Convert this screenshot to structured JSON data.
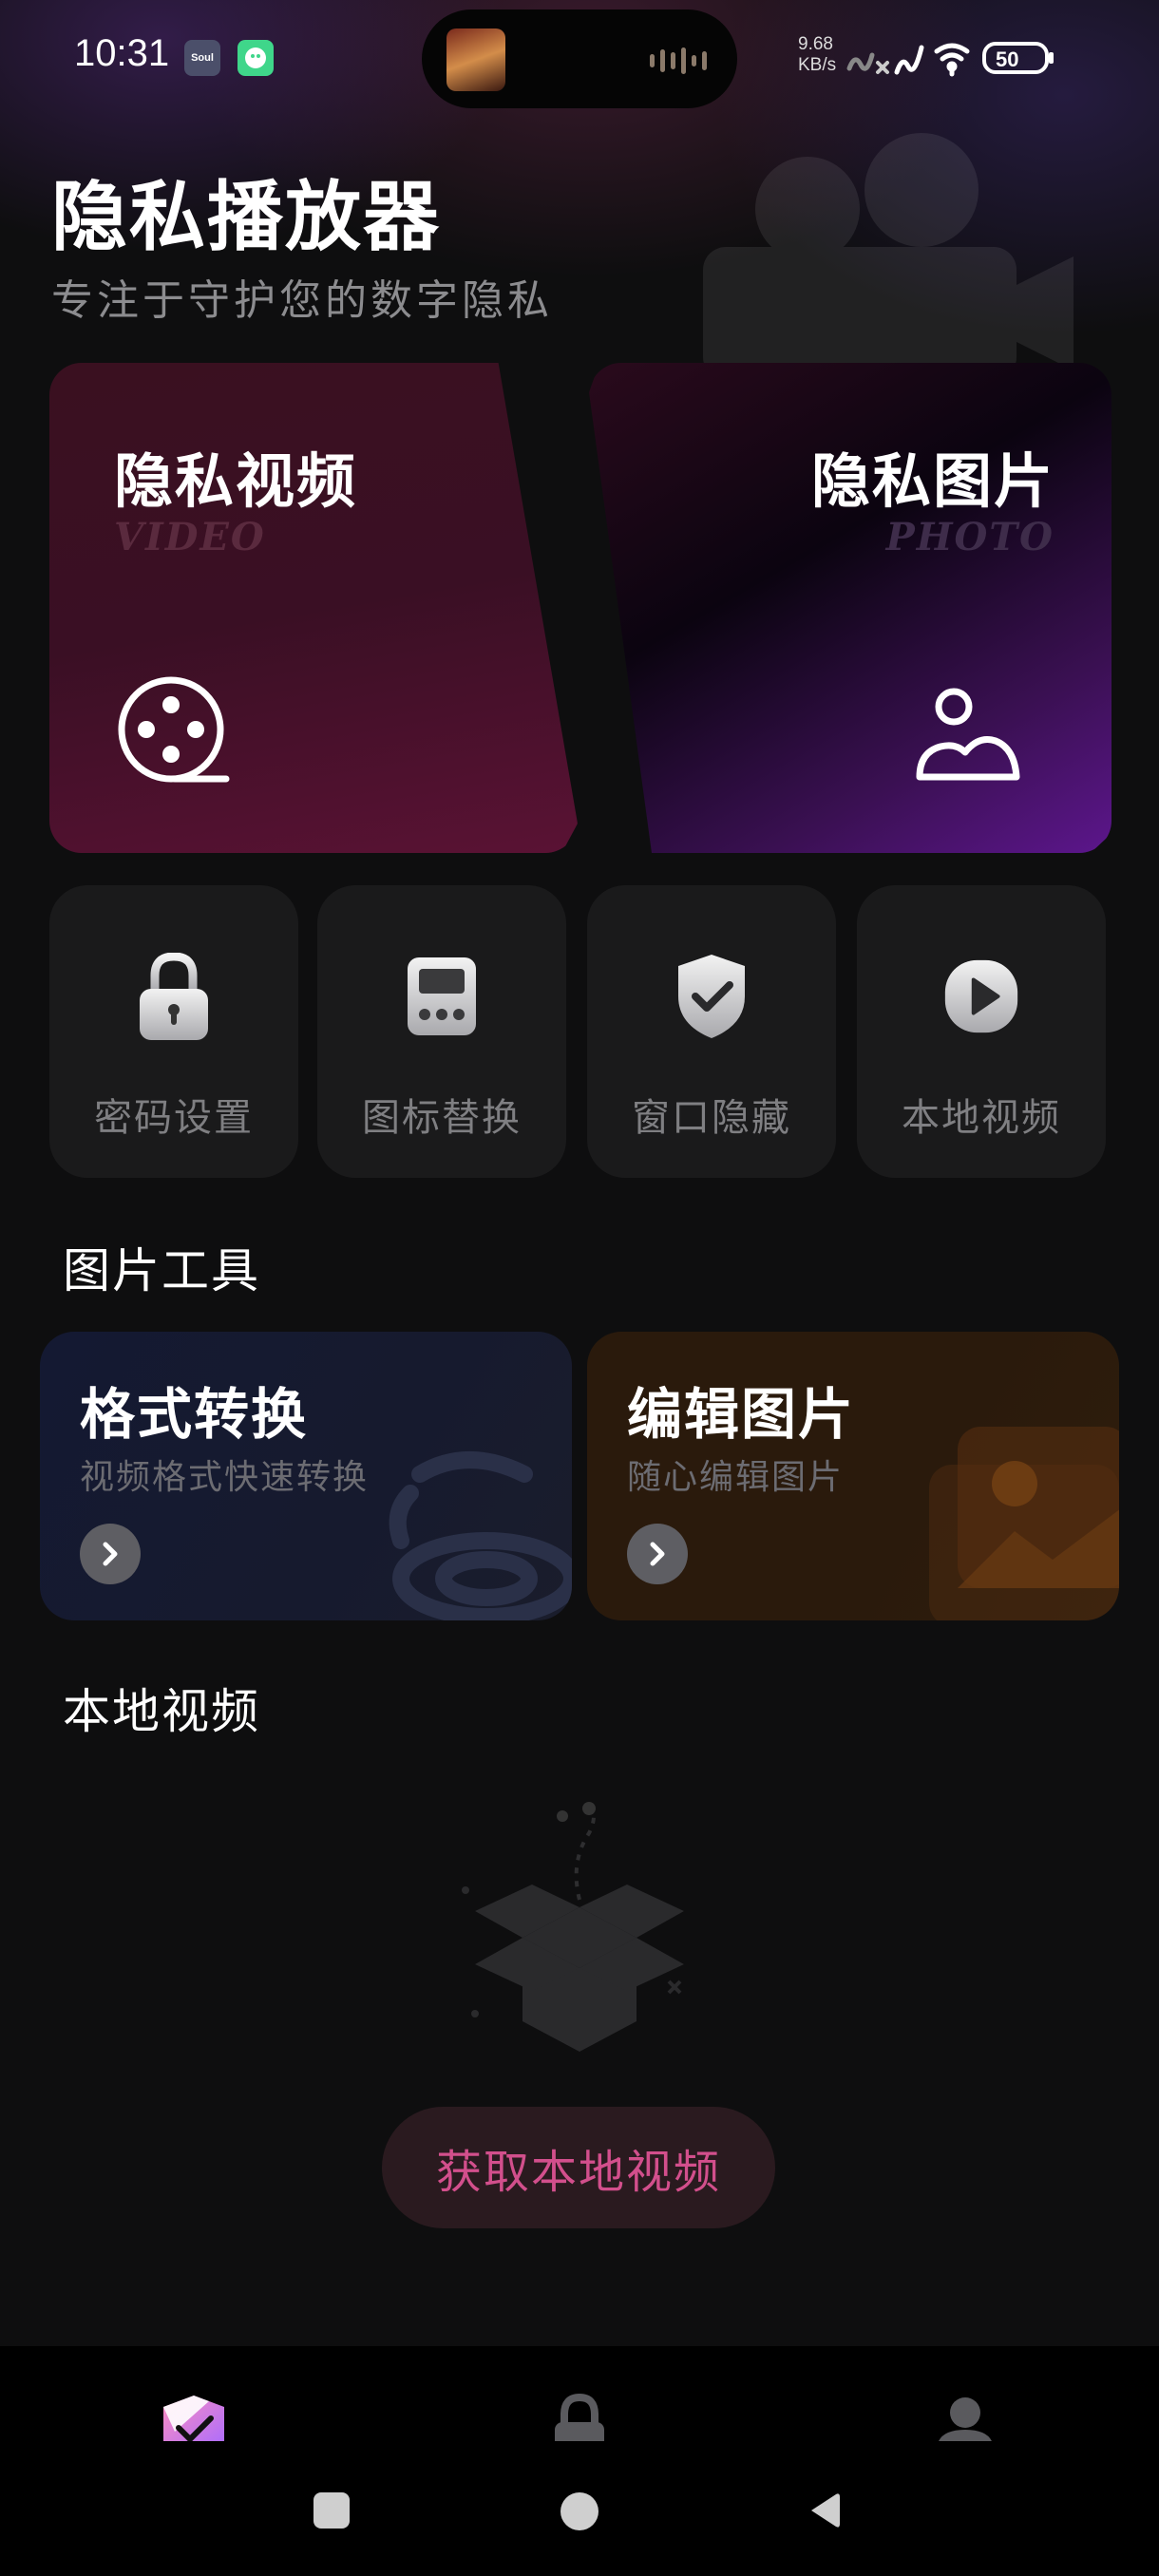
{
  "status_bar": {
    "time": "10:31",
    "soul_badge": "Soul",
    "net_speed_value": "9.68",
    "net_speed_unit": "KB/s",
    "battery": "50"
  },
  "header": {
    "title": "隐私播放器",
    "subtitle": "专注于守护您的数字隐私"
  },
  "feature_cards": [
    {
      "title": "隐私视频",
      "subtitle": "VIDEO",
      "icon": "film-reel-icon"
    },
    {
      "title": "隐私图片",
      "subtitle": "PHOTO",
      "icon": "landscape-photo-icon"
    }
  ],
  "quick_tools": [
    {
      "label": "密码设置",
      "icon": "lock-icon"
    },
    {
      "label": "图标替换",
      "icon": "calculator-icon"
    },
    {
      "label": "窗口隐藏",
      "icon": "shield-check-icon"
    },
    {
      "label": "本地视频",
      "icon": "play-icon"
    }
  ],
  "image_tools": {
    "section_title": "图片工具",
    "items": [
      {
        "title": "格式转换",
        "subtitle": "视频格式快速转换",
        "icon": "chevron-right-icon"
      },
      {
        "title": "编辑图片",
        "subtitle": "随心编辑图片",
        "icon": "chevron-right-icon"
      }
    ]
  },
  "local_video": {
    "section_title": "本地视频",
    "empty_illustration": "empty-box-icon",
    "fetch_button": "获取本地视频"
  },
  "tabbar": {
    "tabs": [
      {
        "icon": "shield-check-tab-icon",
        "active": true
      },
      {
        "icon": "lock-tab-icon",
        "active": false
      },
      {
        "icon": "profile-tab-icon",
        "active": false
      }
    ]
  },
  "colors": {
    "accent_pink": "#d24f8c",
    "background": "#0e0e0f",
    "video_card": "#5a1234",
    "photo_card": "#5c168c"
  }
}
